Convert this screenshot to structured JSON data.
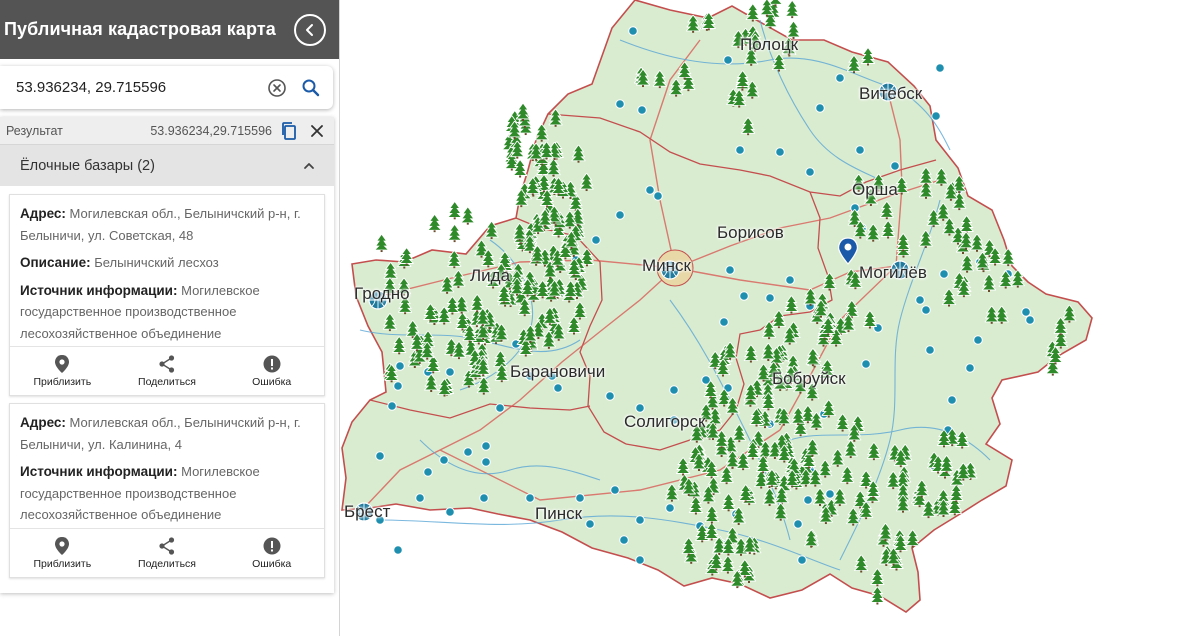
{
  "header": {
    "title": "Публичная кадастровая карта",
    "back_icon": "chevron-left-icon"
  },
  "search": {
    "value": "53.936234, 29.715596",
    "clear_icon": "clear-circle-icon",
    "search_icon": "search-icon"
  },
  "result": {
    "label": "Результат",
    "coords": "53.936234,29.715596",
    "copy_icon": "copy-icon",
    "close_icon": "close-icon"
  },
  "group": {
    "title": "Ёлочные базары (2)",
    "toggle_icon": "chevron-up-icon"
  },
  "cards": [
    {
      "fields": [
        {
          "label": "Адрес:",
          "value": "Могилевская обл., Белыничский р-н, г. Белыничи, ул. Советская, 48"
        },
        {
          "label": "Описание:",
          "value": "Белыничский лесхоз"
        },
        {
          "label": "Источник информации:",
          "value": "Могилевское государственное производственное лесохозяйственное объединение"
        }
      ]
    },
    {
      "fields": [
        {
          "label": "Адрес:",
          "value": "Могилевская обл., Белыничский р-н, г. Белыничи, ул. Калинина, 4"
        },
        {
          "label": "Источник информации:",
          "value": "Могилевское государственное производственное лесохозяйственное объединение"
        }
      ]
    }
  ],
  "actions": {
    "zoom": "Приблизить",
    "share": "Поделиться",
    "error": "Ошибка"
  },
  "map": {
    "cities": [
      "Полоцк",
      "Витебск",
      "Орша",
      "Борисов",
      "Минск",
      "Могилёв",
      "Гродно",
      "Лида",
      "Барановичи",
      "Бобруйск",
      "Солигорск",
      "Пинск",
      "Брест"
    ],
    "colors": {
      "region_fill": "#d9ecd0",
      "border": "#c44e4e",
      "river": "#5aa6d6",
      "marker_blue": "#1f8fb0",
      "tree": "#2f8a2a",
      "pin": "#1a5aa8"
    }
  }
}
